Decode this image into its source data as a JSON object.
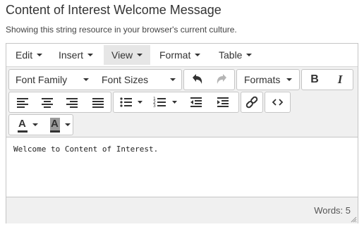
{
  "page": {
    "title": "Content of Interest Welcome Message",
    "subtitle": "Showing this string resource in your browser's current culture."
  },
  "menubar": {
    "items": [
      {
        "label": "Edit"
      },
      {
        "label": "Insert"
      },
      {
        "label": "View"
      },
      {
        "label": "Format"
      },
      {
        "label": "Table"
      }
    ],
    "active": "View"
  },
  "toolbar": {
    "font_family": "Font Family",
    "font_sizes": "Font Sizes",
    "formats": "Formats",
    "bold": "B",
    "italic": "I",
    "text_color_glyph": "A",
    "bg_color_glyph": "A",
    "icons": [
      "undo-icon",
      "redo-icon",
      "align-left-icon",
      "align-center-icon",
      "align-right-icon",
      "align-justify-icon",
      "bullet-list-icon",
      "numbered-list-icon",
      "outdent-icon",
      "indent-icon",
      "link-icon",
      "code-icon",
      "text-color-icon",
      "background-color-icon"
    ]
  },
  "editor": {
    "content": "Welcome to Content of Interest."
  },
  "status": {
    "word_count": "Words: 5"
  },
  "colors": {
    "toolbar_bg": "#f0f0f0",
    "border": "#c5c5c5",
    "active_menu": "#e6e6e6"
  }
}
